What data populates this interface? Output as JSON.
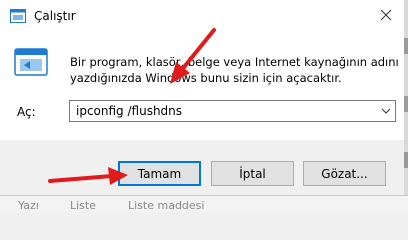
{
  "window": {
    "title": "Çalıştır",
    "description_line1": "Bir program, klasör, belge veya Internet kaynağının adını",
    "description_line2": "yazdığınızda Windows bunu sizin için açacaktır.",
    "open_label": "Aç:",
    "input_value": "ipconfig /flushdns",
    "icons": {
      "app": "run-icon",
      "close": "close-icon",
      "dropdown": "chevron-down-icon",
      "large": "run-dialog-icon"
    }
  },
  "buttons": {
    "ok": "Tamam",
    "cancel": "İptal",
    "browse": "Gözat..."
  },
  "background_strip": [
    "Yazı",
    "Liste",
    "Liste maddesi"
  ],
  "colors": {
    "arrow": "#e11b1b",
    "focus": "#0078d7"
  }
}
